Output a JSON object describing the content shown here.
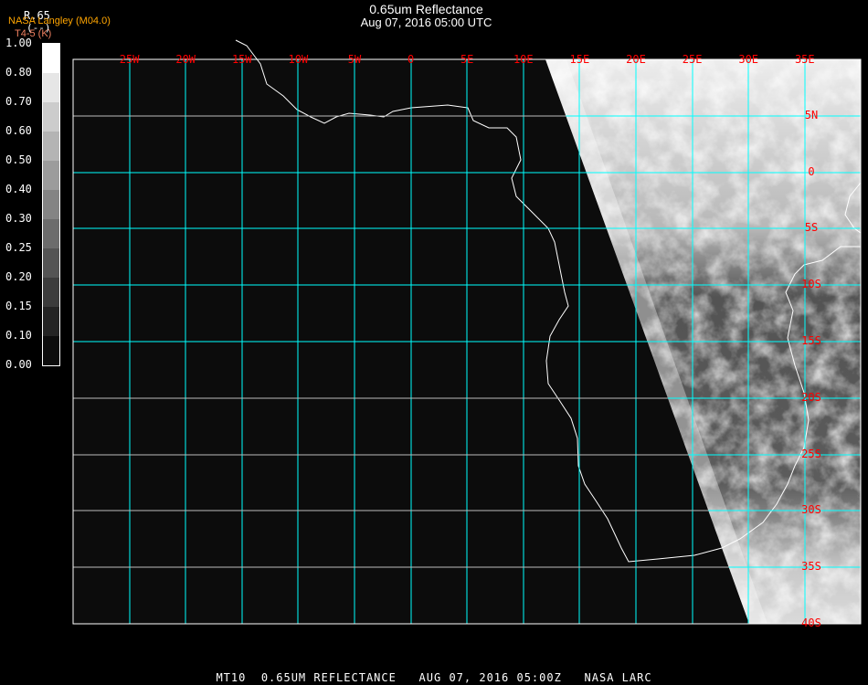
{
  "header": {
    "title": "0.65um Reflectance",
    "subtitle": "Aug 07, 2016 05:00 UTC",
    "product": "R.65",
    "product_units_placeholder": "(--)",
    "organization": "NASA Langley (M04.0)",
    "units": "T4-5 (K)"
  },
  "legend": {
    "labels": [
      "1.00",
      "0.80",
      "0.70",
      "0.60",
      "0.50",
      "0.40",
      "0.30",
      "0.25",
      "0.20",
      "0.15",
      "0.10",
      "0.00"
    ],
    "colors": [
      "#ffffff",
      "#e6e6e6",
      "#cccccc",
      "#b4b4b4",
      "#9c9c9c",
      "#848484",
      "#6c6c6c",
      "#545454",
      "#3c3c3c",
      "#242424",
      "#0c0c0c"
    ]
  },
  "map": {
    "longitude_labels": [
      "25W",
      "20W",
      "15W",
      "10W",
      "5W",
      "0",
      "5E",
      "10E",
      "15E",
      "20E",
      "25E",
      "30E",
      "35E"
    ],
    "latitude_labels": [
      "5N",
      "0",
      "5S",
      "10S",
      "15S",
      "20S",
      "25S",
      "30S",
      "35S",
      "40S"
    ],
    "grid_color": "#00ffff",
    "label_color": "#ff0000",
    "coastline_color": "#ffffff"
  },
  "footer": {
    "satellite": "MT10",
    "product": "0.65UM REFLECTANCE",
    "datetime": "AUG 07, 2016 05:00Z",
    "source": "NASA LARC"
  }
}
